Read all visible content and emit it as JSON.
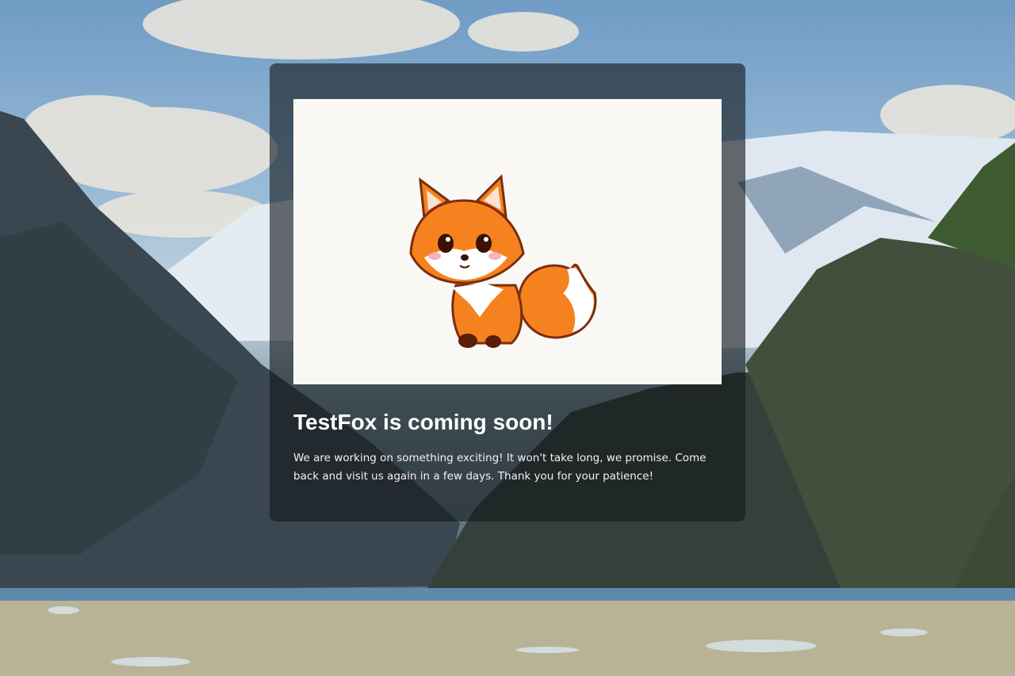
{
  "page": {
    "title": "TestFox is coming soon!",
    "message": "We are working on something exciting! It won't take long, we promise. Come back and visit us again in a few days. Thank you for your patience!"
  },
  "hero_image": {
    "icon": "fox-mascot-illustration"
  },
  "background": {
    "icon": "mountain-fjord-landscape"
  },
  "colors": {
    "card_overlay": "#14181c",
    "title_text": "#ffffff",
    "hero_background": "#f9f8f4",
    "fox_orange": "#f5821f",
    "fox_outline": "#7a2e0e"
  }
}
